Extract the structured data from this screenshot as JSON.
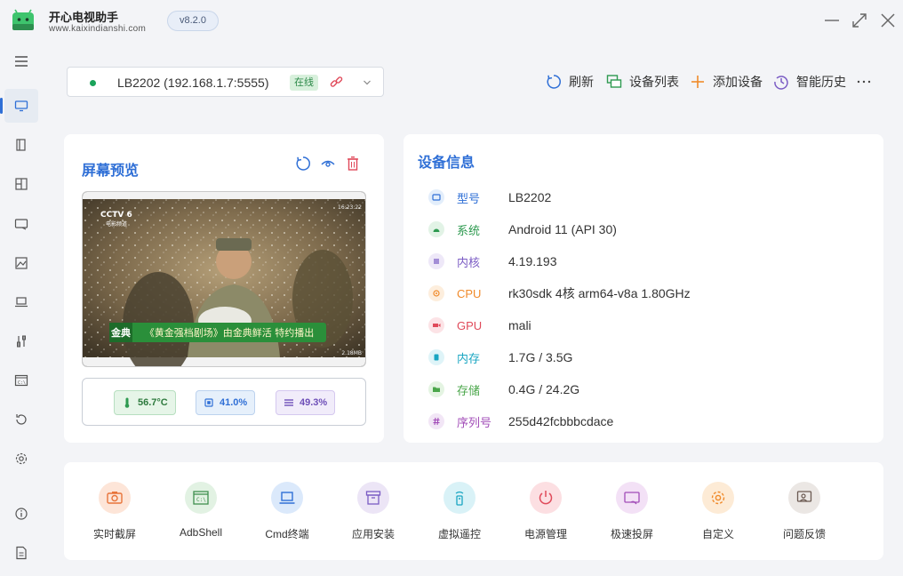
{
  "app": {
    "name": "开心电视助手",
    "url": "www.kaixindianshi.com",
    "version": "v8.2.0"
  },
  "device": {
    "name": "LB2202 (192.168.1.7:5555)",
    "status": "在线"
  },
  "toolbar": {
    "refresh": "刷新",
    "device_list": "设备列表",
    "add_device": "添加设备",
    "history": "智能历史"
  },
  "preview": {
    "title": "屏幕预览",
    "channel_logo": "CCTV 6",
    "channel_sub": "电影频道",
    "time": "16:23:22",
    "banner_left": "金典",
    "banner_text": "《黄金强档剧场》由金典鲜活 特约播出",
    "rate": "2.18MB",
    "temperature": "56.7°C",
    "cpu_usage": "41.0%",
    "memory_usage": "49.3%"
  },
  "device_info": {
    "title": "设备信息",
    "rows": [
      {
        "label": "型号",
        "value": "LB2202"
      },
      {
        "label": "系统",
        "value": "Android 11 (API 30)"
      },
      {
        "label": "内核",
        "value": "4.19.193"
      },
      {
        "label": "CPU",
        "value": "rk30sdk 4核 arm64-v8a 1.80GHz"
      },
      {
        "label": "GPU",
        "value": "mali"
      },
      {
        "label": "内存",
        "value": "1.7G / 3.5G"
      },
      {
        "label": "存储",
        "value": "0.4G / 24.2G"
      },
      {
        "label": "序列号",
        "value": "255d42fcbbbcdace"
      }
    ]
  },
  "tools": [
    {
      "label": "实时截屏",
      "icon": "camera-icon"
    },
    {
      "label": "AdbShell",
      "icon": "terminal-window-icon"
    },
    {
      "label": "Cmd终端",
      "icon": "laptop-icon"
    },
    {
      "label": "应用安装",
      "icon": "archive-icon"
    },
    {
      "label": "虚拟遥控",
      "icon": "remote-icon"
    },
    {
      "label": "电源管理",
      "icon": "power-icon"
    },
    {
      "label": "极速投屏",
      "icon": "cast-icon"
    },
    {
      "label": "自定义",
      "icon": "gear-icon"
    },
    {
      "label": "问题反馈",
      "icon": "feedback-icon"
    }
  ],
  "colors": {
    "accent": "#2f6fd6",
    "online": "#1aa35a"
  }
}
